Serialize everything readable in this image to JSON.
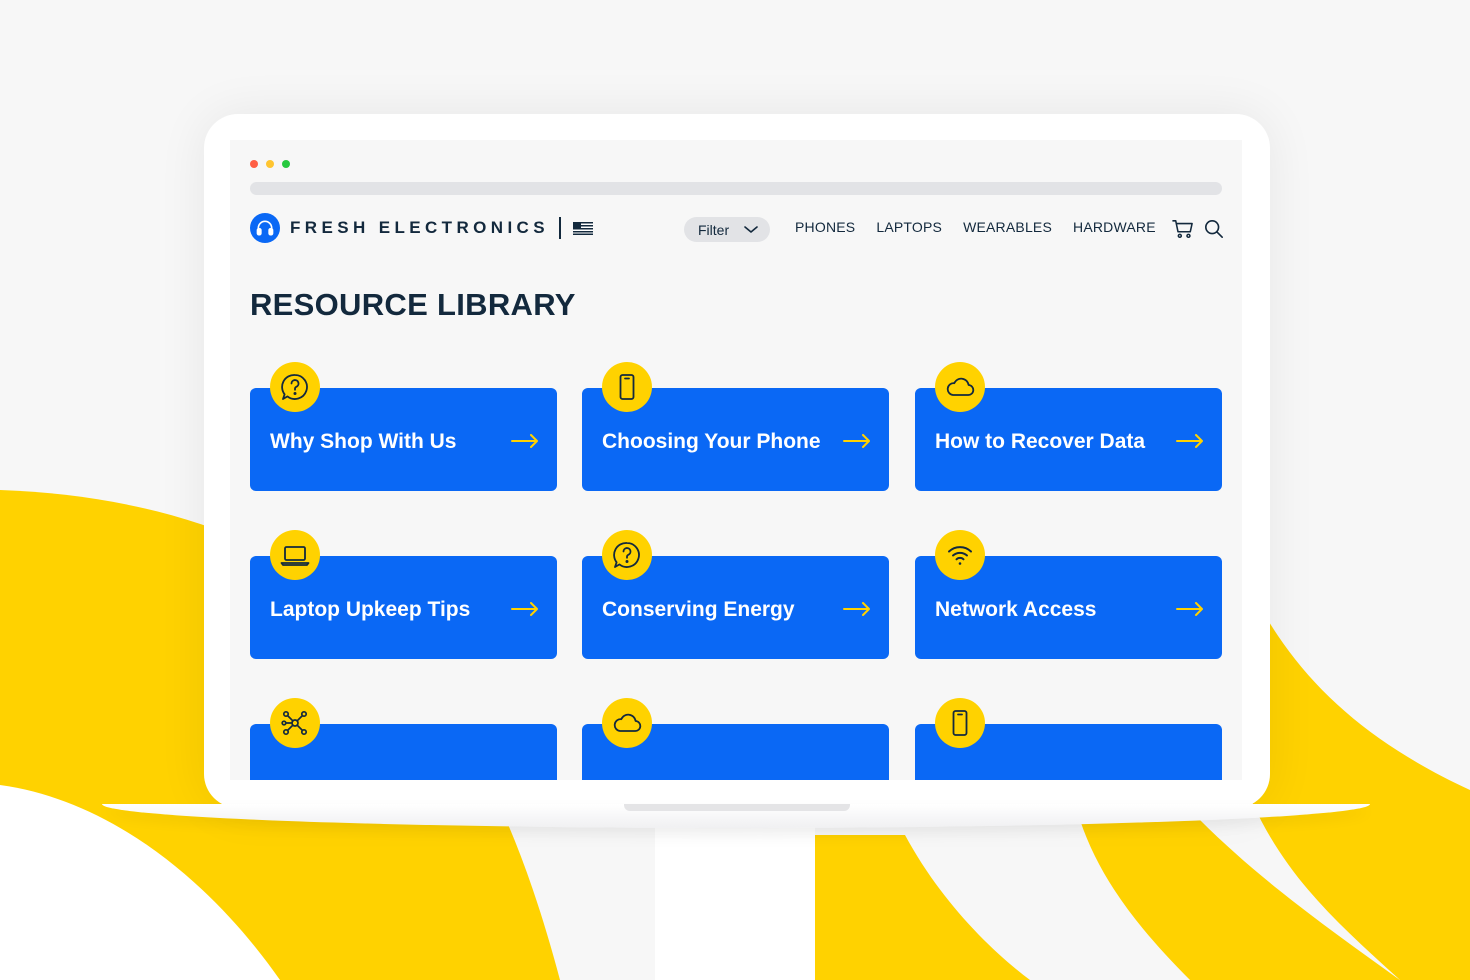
{
  "colors": {
    "brand_blue": "#0a68f5",
    "accent_yellow": "#ffd200",
    "navy_text": "#13293d",
    "background": "#f7f7f7",
    "window_dot_red": "#ff5f45",
    "window_dot_yellow": "#ffc530",
    "window_dot_green": "#27c93f"
  },
  "header": {
    "logo_icon": "headphones-icon",
    "brand": "FRESH ELECTRONICS",
    "flag_icon": "us-flag-icon",
    "filter_label": "Filter",
    "nav": [
      "PHONES",
      "LAPTOPS",
      "WEARABLES",
      "HARDWARE"
    ],
    "cart_icon": "cart-icon",
    "search_icon": "search-icon"
  },
  "page": {
    "title": "RESOURCE LIBRARY"
  },
  "cards": [
    {
      "title": "Why Shop With Us",
      "icon": "question-bubble-icon"
    },
    {
      "title": "Choosing Your Phone",
      "icon": "phone-icon"
    },
    {
      "title": "How to Recover Data",
      "icon": "cloud-icon"
    },
    {
      "title": "Laptop Upkeep Tips",
      "icon": "laptop-icon"
    },
    {
      "title": "Conserving Energy",
      "icon": "question-bubble-icon"
    },
    {
      "title": "Network Access",
      "icon": "wifi-icon"
    },
    {
      "title": "",
      "icon": "network-nodes-icon"
    },
    {
      "title": "",
      "icon": "cloud-icon"
    },
    {
      "title": "",
      "icon": "phone-icon"
    }
  ]
}
